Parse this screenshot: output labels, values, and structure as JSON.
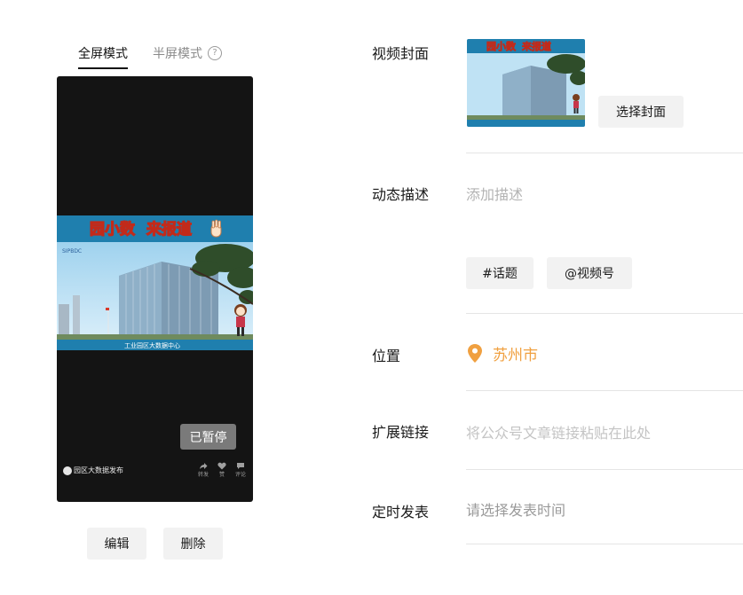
{
  "preview": {
    "tabs": [
      {
        "label": "全屏模式"
      },
      {
        "label": "半屏模式"
      }
    ],
    "help_icon": "?",
    "video": {
      "banner_title_1": "园小数",
      "banner_title_2": "来报道",
      "logo_text": "SIPBDC",
      "caption": "工业园区大数据中心",
      "paused_label": "已暂停",
      "account_name": "园区大数据发布",
      "actions": [
        {
          "icon": "share-icon",
          "label": "转发"
        },
        {
          "icon": "heart-icon",
          "label": "赞"
        },
        {
          "icon": "comment-icon",
          "label": "评论"
        }
      ]
    },
    "edit_button": "编辑",
    "delete_button": "删除"
  },
  "form": {
    "cover": {
      "label": "视频封面",
      "select_button": "选择封面",
      "thumb_title_1": "园小数",
      "thumb_title_2": "来报道"
    },
    "description": {
      "label": "动态描述",
      "placeholder": "添加描述",
      "topic_button": "#话题",
      "mention_button": "@视频号"
    },
    "location": {
      "label": "位置",
      "value": "苏州市",
      "color": "#f0a040"
    },
    "link": {
      "label": "扩展链接",
      "placeholder": "将公众号文章链接粘贴在此处"
    },
    "schedule": {
      "label": "定时发表",
      "placeholder": "请选择发表时间"
    }
  }
}
